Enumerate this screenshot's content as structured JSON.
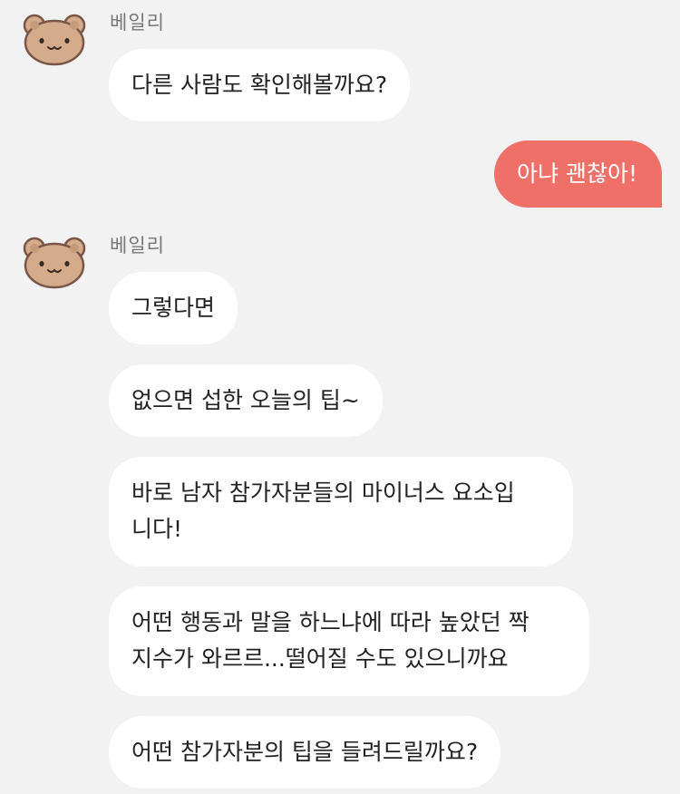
{
  "chat": {
    "groups": [
      {
        "sender": "베일리",
        "avatar_icon": "bear-face-icon",
        "messages": [
          {
            "lines": [
              "다른 사람도 확인해볼까요?"
            ]
          }
        ]
      },
      {
        "sender": "베일리",
        "avatar_icon": "bear-face-icon",
        "messages": [
          {
            "lines": [
              "그렇다면"
            ]
          },
          {
            "lines": [
              "없으면 섭한 오늘의 팁~"
            ]
          },
          {
            "lines": [
              "바로 남자 참가자분들의 마이너스 요소입",
              "니다!"
            ]
          },
          {
            "lines": [
              "어떤 행동과 말을 하느냐에 따라 높았던 짝",
              "지수가 와르르...떨어질 수도 있으니까요"
            ]
          },
          {
            "lines": [
              "어떤 참가자분의 팁을 들려드릴까요?"
            ]
          }
        ]
      }
    ],
    "outgoing": [
      {
        "text": "아냐 괜찮아!"
      }
    ]
  },
  "colors": {
    "background": "#f2f2f2",
    "incoming_bubble": "#ffffff",
    "outgoing_bubble": "#ef7069",
    "avatar_fur": "#d4ac8c",
    "avatar_outline": "#7a5646"
  }
}
